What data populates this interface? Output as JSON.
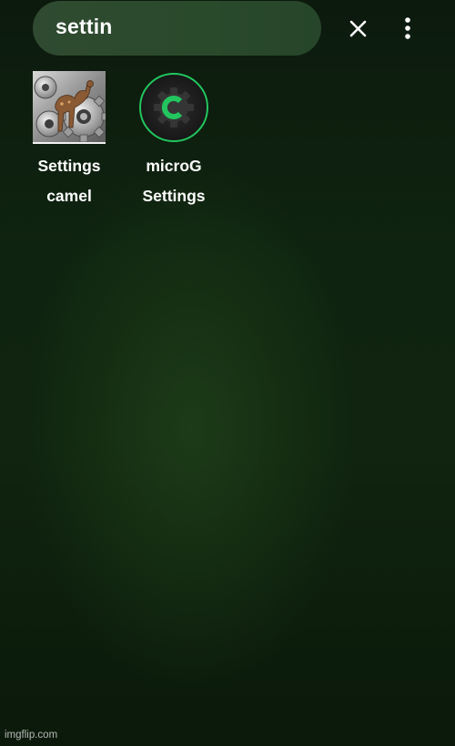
{
  "search": {
    "query": "settin"
  },
  "toolbar": {
    "clear_icon": "close-icon",
    "menu_icon": "more-vert-icon"
  },
  "results": [
    {
      "label": "Settings camel",
      "icon": "gears-camel-icon"
    },
    {
      "label": "microG Settings",
      "icon": "microg-gear-icon"
    }
  ],
  "colors": {
    "background": "#10240f",
    "search_bar": "#2c4a2e",
    "microg_accent": "#22c55e"
  },
  "watermark": "imgflip.com"
}
